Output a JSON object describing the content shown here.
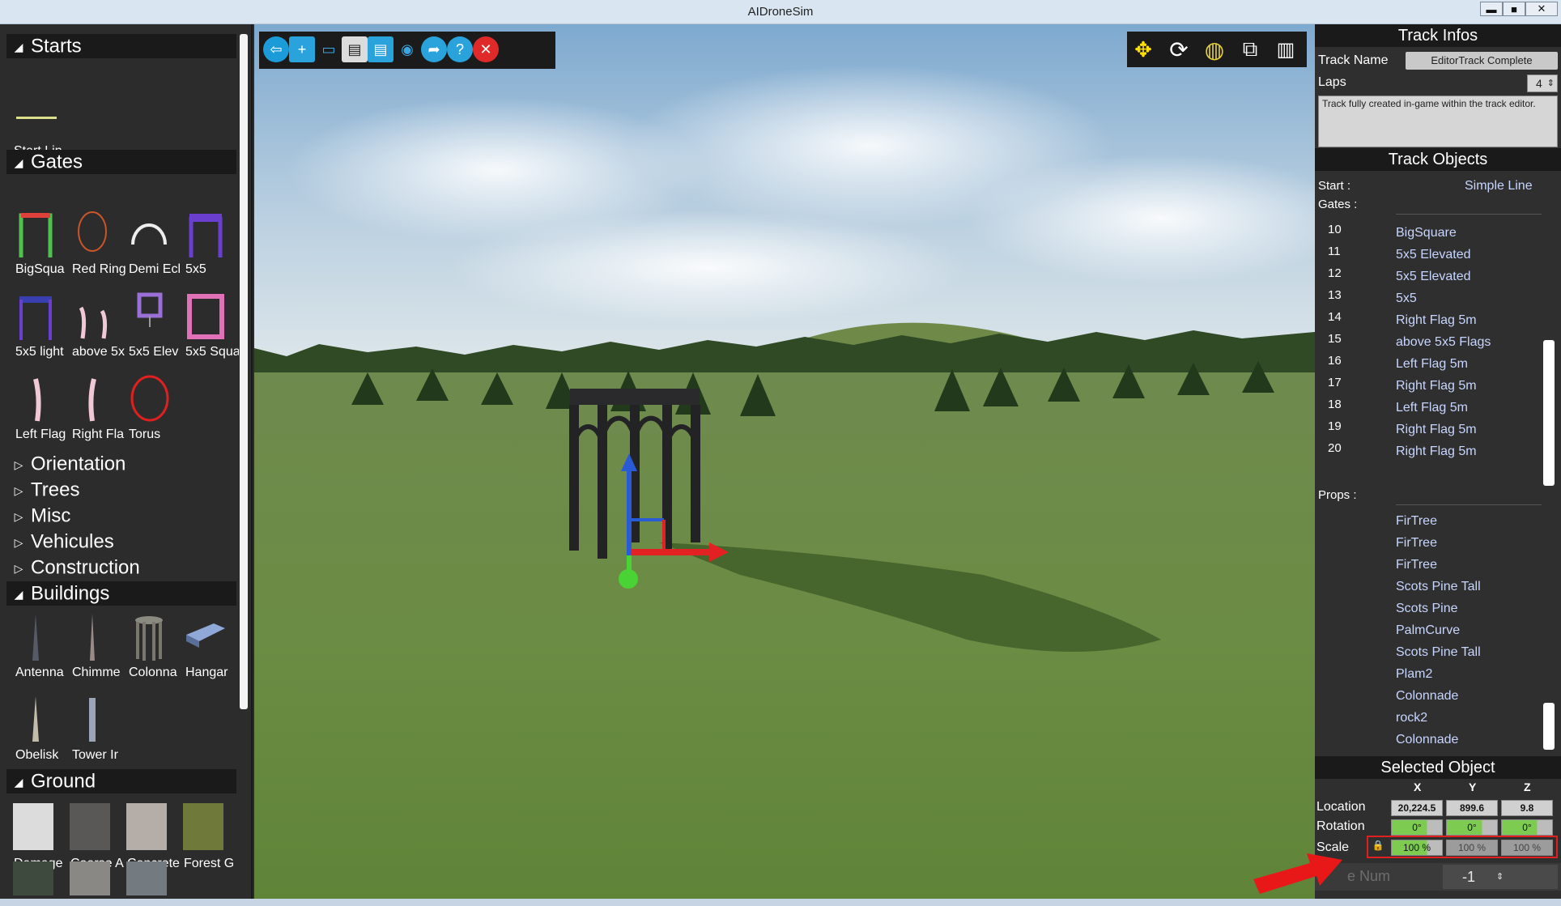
{
  "window": {
    "title": "AIDroneSim",
    "min": "▬",
    "max": "■",
    "close": "✕"
  },
  "left_panel": {
    "sections": [
      {
        "name": "Starts",
        "expanded": true,
        "items": [
          "Start Lin"
        ]
      },
      {
        "name": "Gates",
        "expanded": true,
        "items": [
          "BigSqua",
          "Red Ring",
          "Demi Ecl",
          "5x5",
          "5x5 light",
          "above 5x",
          "5x5 Elev",
          "5x5 Squa",
          "Left Flag",
          "Right Fla",
          "Torus"
        ]
      },
      {
        "name": "Orientation",
        "expanded": false
      },
      {
        "name": "Trees",
        "expanded": false
      },
      {
        "name": "Misc",
        "expanded": false
      },
      {
        "name": "Vehicules",
        "expanded": false
      },
      {
        "name": "Construction",
        "expanded": false
      },
      {
        "name": "Buildings",
        "expanded": true,
        "items": [
          "Antenna",
          "Chimme",
          "Colonna",
          "Hangar",
          "Obelisk",
          "Tower Ir"
        ]
      },
      {
        "name": "Ground",
        "expanded": true,
        "items": [
          "Damage",
          "Coarse A",
          "Concrete",
          "Forest G"
        ]
      }
    ]
  },
  "toolbar": {
    "left_icons": [
      "exit-editor-icon",
      "new-track-icon",
      "open-folder-icon",
      "save-icon",
      "save-as-icon",
      "screenshot-icon",
      "share-icon",
      "help-icon",
      "close-icon"
    ],
    "right_icons": [
      "move-gizmo-icon",
      "rotate-icon",
      "world-space-icon",
      "duplicate-icon",
      "delete-icon"
    ],
    "help_glyph": "?",
    "close_glyph": "✕"
  },
  "track_infos": {
    "header": "Track Infos",
    "track_name_label": "Track Name",
    "track_name_value": "EditorTrack Complete",
    "laps_label": "Laps",
    "laps_value": "4",
    "description": "Track fully created in-game within the track editor."
  },
  "track_objects": {
    "header": "Track Objects",
    "start_label": "Start :",
    "start_value": "Simple Line",
    "gates_label": "Gates :",
    "gates": [
      {
        "num": "10",
        "name": "BigSquare"
      },
      {
        "num": "11",
        "name": "5x5 Elevated"
      },
      {
        "num": "12",
        "name": "5x5 Elevated"
      },
      {
        "num": "13",
        "name": "5x5"
      },
      {
        "num": "14",
        "name": "Right Flag 5m"
      },
      {
        "num": "15",
        "name": "above 5x5 Flags"
      },
      {
        "num": "16",
        "name": "Left Flag 5m"
      },
      {
        "num": "17",
        "name": "Right Flag 5m"
      },
      {
        "num": "18",
        "name": "Left Flag 5m"
      },
      {
        "num": "19",
        "name": "Right Flag 5m"
      },
      {
        "num": "20",
        "name": "Right Flag 5m"
      }
    ],
    "props_label": "Props :",
    "props": [
      "FirTree",
      "FirTree",
      "FirTree",
      "Scots Pine Tall",
      "Scots Pine",
      "PalmCurve",
      "Scots Pine Tall",
      "Plam2",
      "Colonnade",
      "rock2",
      "Colonnade"
    ]
  },
  "selected_object": {
    "header": "Selected Object",
    "axes": [
      "X",
      "Y",
      "Z"
    ],
    "location_label": "Location",
    "location": [
      "20,224.5",
      "899.6",
      "9.8"
    ],
    "rotation_label": "Rotation",
    "rotation": [
      "0°",
      "0°",
      "0°"
    ],
    "scale_label": "Scale",
    "scale": [
      "100 %",
      "100 %",
      "100 %"
    ],
    "gate_num_label": "e Num",
    "gate_num_value": "-1",
    "lock_glyph": "🔒"
  },
  "colors": {
    "panel_bg": "#2c2c2c",
    "header_bg": "#1a1a1a",
    "link_text": "#c7d6ff",
    "field_green": "#7ecb52",
    "highlight_red": "#e02020"
  }
}
